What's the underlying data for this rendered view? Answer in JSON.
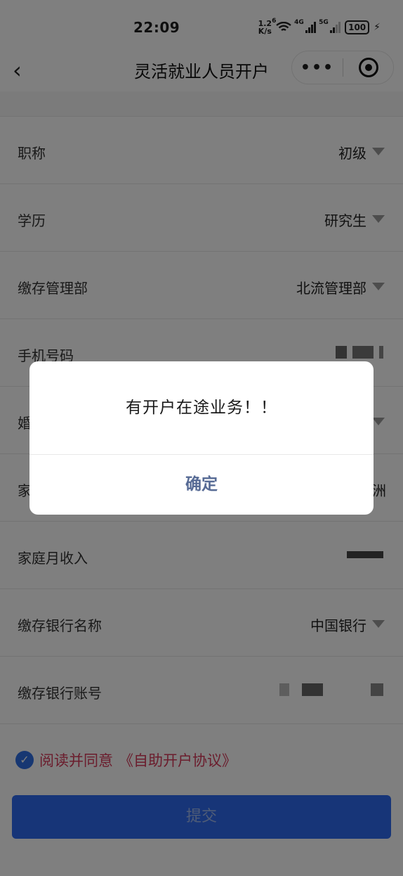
{
  "status_bar": {
    "time": "22:09",
    "net_speed_value": "1.2",
    "net_speed_unit": "K/s",
    "wifi_badge": "6",
    "sig1_label": "4G",
    "sig2_label": "5G",
    "battery": "100"
  },
  "nav": {
    "back_icon": "‹",
    "title": "灵活就业人员开户",
    "more_icon": "•••"
  },
  "form": {
    "rows": [
      {
        "label": "职称",
        "value": "初级"
      },
      {
        "label": "学历",
        "value": "研究生"
      },
      {
        "label": "缴存管理部",
        "value": "北流管理部"
      },
      {
        "label": "手机号码",
        "value": ""
      },
      {
        "label": "婚",
        "value": ""
      },
      {
        "label": "家",
        "value": "洲"
      },
      {
        "label": "家庭月收入",
        "value": ""
      },
      {
        "label": "缴存银行名称",
        "value": "中国银行"
      },
      {
        "label": "缴存银行账号",
        "value": ""
      }
    ]
  },
  "agreement": {
    "text": "阅读并同意",
    "link": "《自助开户协议》"
  },
  "submit": {
    "label": "提交"
  },
  "dialog": {
    "message": "有开户在途业务！！",
    "confirm": "确定"
  },
  "colors": {
    "accent": "#2e6bf0",
    "link": "#d63a5a",
    "dialog_button": "#576b95"
  }
}
